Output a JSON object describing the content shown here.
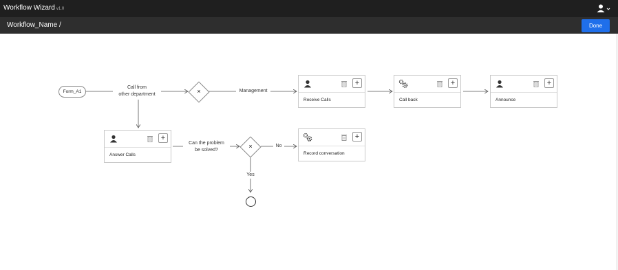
{
  "app": {
    "title": "Workflow Wizard",
    "version": "v1.0"
  },
  "header": {
    "breadcrumb": "Workflow_Name /",
    "done_label": "Done"
  },
  "diagram": {
    "start_form": "Form_A1",
    "labels": {
      "call_from": "Call from",
      "other_department": "other department",
      "management": "Management",
      "can_problem": "Can the problem",
      "be_solved": "be solved?",
      "no": "No",
      "yes": "Yes"
    },
    "gateway_symbol": "×",
    "tasks": [
      {
        "name": "Receive Calls",
        "icon": "user-icon"
      },
      {
        "name": "Call back",
        "icon": "gears-icon"
      },
      {
        "name": "Announce",
        "icon": "user-icon"
      },
      {
        "name": "Answer Calls",
        "icon": "user-icon"
      },
      {
        "name": "Record conversation",
        "icon": "gears-icon"
      }
    ],
    "add_symbol": "+"
  }
}
